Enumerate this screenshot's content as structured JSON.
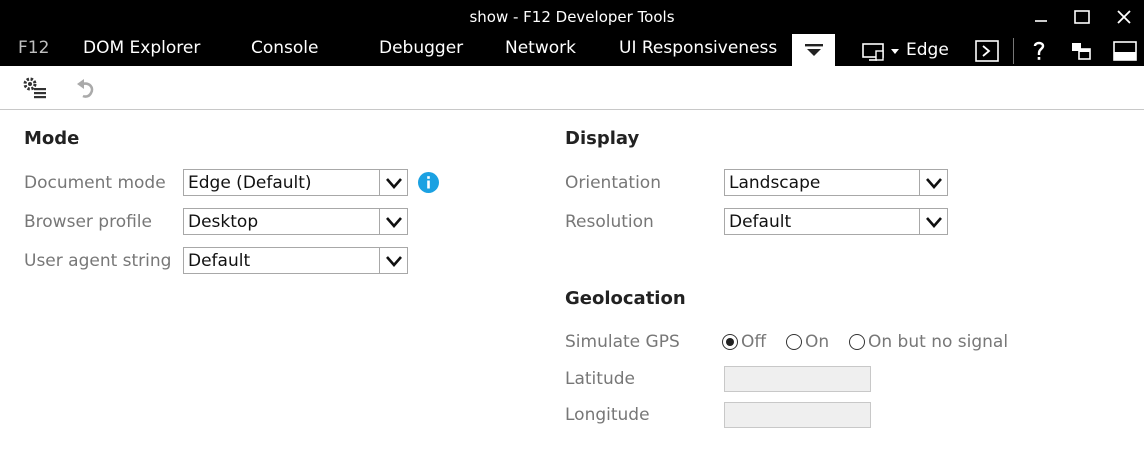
{
  "window": {
    "title": "show - F12 Developer Tools"
  },
  "tabs": {
    "f12": "F12",
    "dom_explorer": "DOM Explorer",
    "console": "Console",
    "debugger": "Debugger",
    "network": "Network",
    "ui_responsiveness": "UI Responsiveness"
  },
  "target": {
    "label": "Edge"
  },
  "mode": {
    "title": "Mode",
    "document_mode": {
      "label": "Document mode",
      "value": "Edge (Default)"
    },
    "browser_profile": {
      "label": "Browser profile",
      "value": "Desktop"
    },
    "user_agent": {
      "label": "User agent string",
      "value": "Default"
    }
  },
  "display": {
    "title": "Display",
    "orientation": {
      "label": "Orientation",
      "value": "Landscape"
    },
    "resolution": {
      "label": "Resolution",
      "value": "Default"
    }
  },
  "geolocation": {
    "title": "Geolocation",
    "simulate_gps": {
      "label": "Simulate GPS",
      "options": [
        "Off",
        "On",
        "On but no signal"
      ],
      "selected": "Off"
    },
    "latitude": {
      "label": "Latitude",
      "value": ""
    },
    "longitude": {
      "label": "Longitude",
      "value": ""
    }
  },
  "colors": {
    "titlebar": "#000000",
    "info_icon": "#1ba1e2",
    "tab_text": "#ffffff"
  },
  "icons": [
    "minimize-icon",
    "maximize-icon",
    "close-icon",
    "menu-triangle-icon",
    "screen-icon",
    "console-prompt-icon",
    "help-icon",
    "undock-icon",
    "dock-bottom-icon",
    "settings-icon",
    "undo-icon",
    "info-icon",
    "dropdown-arrow-icon"
  ]
}
